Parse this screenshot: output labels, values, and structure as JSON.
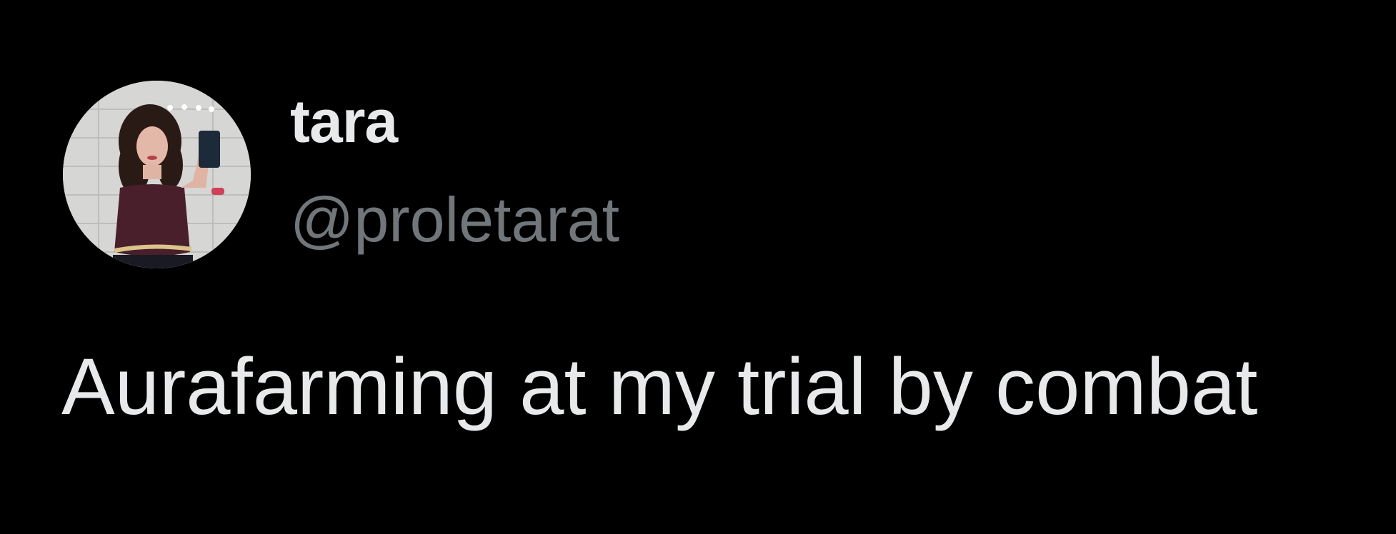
{
  "author": {
    "display_name": "tara",
    "handle": "@proletarat",
    "avatar_icon": "profile-photo"
  },
  "tweet": {
    "text": "Aurafarming at my trial by combat"
  },
  "colors": {
    "background": "#000000",
    "primary_text": "#e7e9ea",
    "secondary_text": "#71767b"
  }
}
